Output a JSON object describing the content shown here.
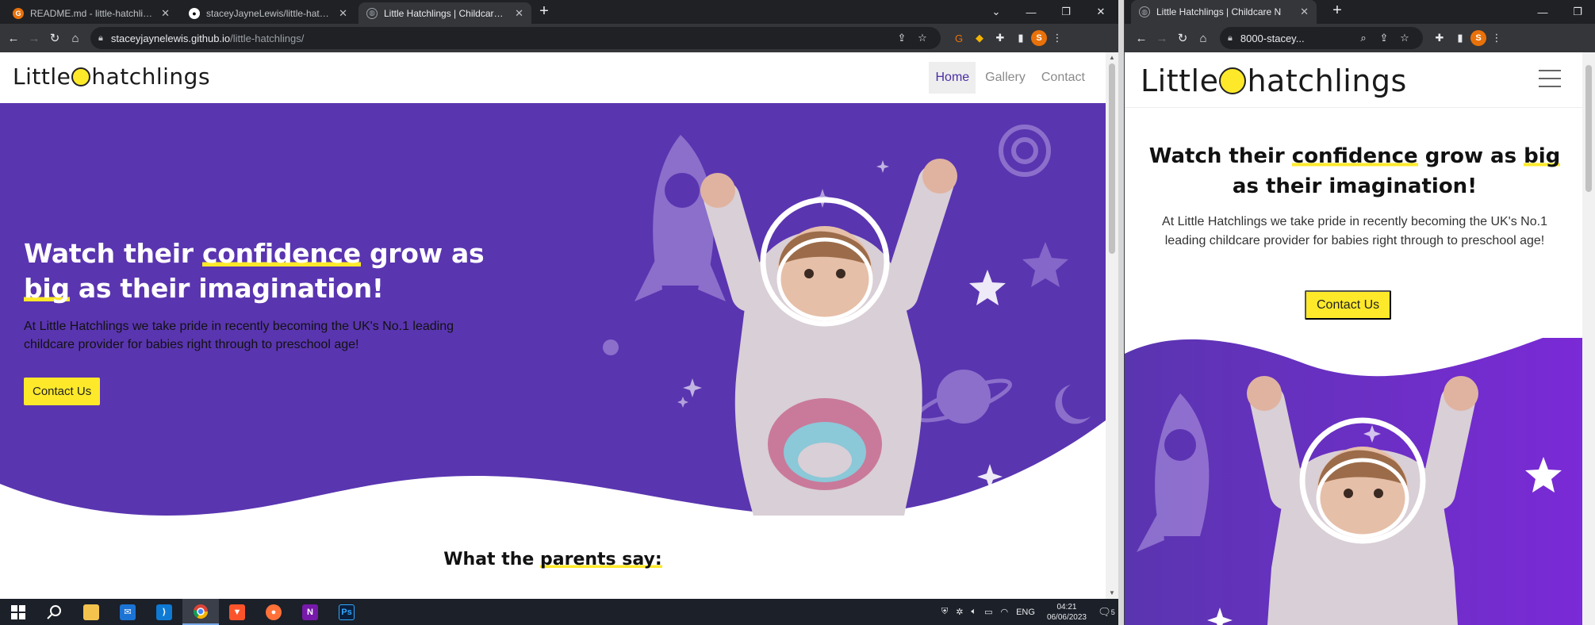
{
  "left_browser": {
    "tabs": [
      {
        "title": "README.md - little-hatchlings - G",
        "favicon": "G"
      },
      {
        "title": "staceyJayneLewis/little-hatchlings",
        "favicon": "github"
      },
      {
        "title": "Little Hatchlings | Childcare Nurs",
        "favicon": "globe"
      }
    ],
    "address_host": "staceyjaynelewis.github.io",
    "address_path": "/little-hatchlings/",
    "profile_initial": "S"
  },
  "right_browser": {
    "tab_title": "Little Hatchlings | Childcare N",
    "address": "8000-stacey...",
    "profile_initial": "S"
  },
  "site": {
    "logo_left": "Little",
    "logo_right": "hatchlings",
    "nav": [
      {
        "label": "Home",
        "active": true
      },
      {
        "label": "Gallery",
        "active": false
      },
      {
        "label": "Contact",
        "active": false
      }
    ],
    "headline": {
      "p1": "Watch their ",
      "hl1": "confidence",
      "p2": " grow as ",
      "hl2": "big",
      "p3": " as their imagination!"
    },
    "lead": "At Little Hatchlings we take pride in recently becoming the UK's No.1 leading childcare provider for babies right through to preschool age!",
    "cta": "Contact Us",
    "testimonial_title_pre": "What the ",
    "testimonial_title_hl": "parents say:"
  },
  "taskbar": {
    "language": "ENG",
    "time": "04:21",
    "date": "06/06/2023",
    "notification_count": "5"
  },
  "colors": {
    "hero_purple": "#5a35b0",
    "accent_yellow": "#fde92a",
    "nav_active_text": "#4b2ea3"
  }
}
